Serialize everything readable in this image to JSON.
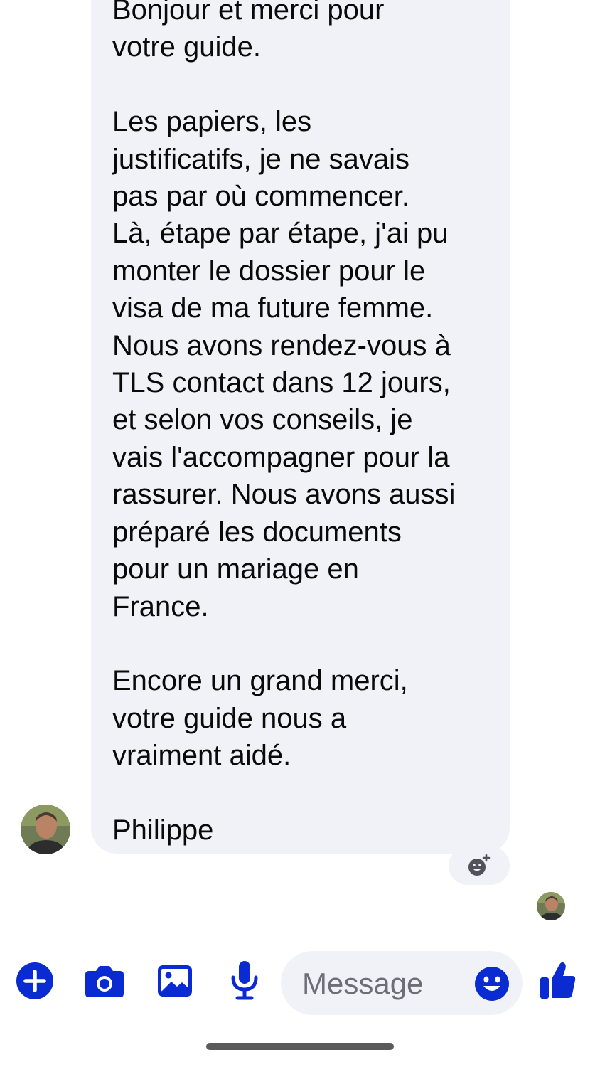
{
  "message": {
    "text": "Bonjour et merci pour\nvotre guide.\n\nLes papiers, les\njustificatifs, je ne savais\npas par où commencer.\nLà, étape par étape, j'ai pu\nmonter le dossier pour le\nvisa de ma future femme.\nNous avons rendez-vous à\nTLS contact dans 12 jours,\net selon vos conseils, je\nvais l'accompagner pour la\nrassurer. Nous avons aussi\npréparé les documents\npour un mariage en\nFrance.\n\nEncore un grand merci,\nvotre guide nous a\nvraiment aidé.\n\nPhilippe"
  },
  "composer": {
    "placeholder": "Message"
  },
  "colors": {
    "accent": "#0a2bd1",
    "bubble": "#f1f2f7",
    "text": "#0a0a0a",
    "placeholder": "#6c6f78"
  },
  "icons": {
    "plus": "plus-circle-icon",
    "camera": "camera-icon",
    "gallery": "image-icon",
    "mic": "microphone-icon",
    "emoji": "smiley-icon",
    "like": "thumbs-up-icon",
    "react": "add-reaction-icon"
  }
}
